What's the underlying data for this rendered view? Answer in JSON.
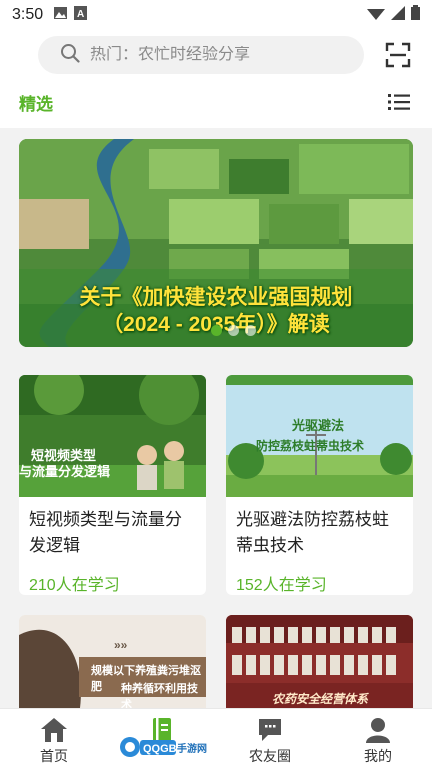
{
  "status_bar": {
    "time": "3:50"
  },
  "search": {
    "placeholder": "热门：农忙时经验分享"
  },
  "tabs": {
    "featured_label": "精选"
  },
  "banner": {
    "title_line1": "关于《加快建设农业强国规划",
    "title_line2": "（2024 - 2035年）》解读",
    "dot_count": 3,
    "active_dot": 0
  },
  "courses": [
    {
      "title": "短视频类型与流量分发逻辑",
      "learners": "210人在学习",
      "thumb_text_1": "短视频类型",
      "thumb_text_2": "与流量分发逻辑"
    },
    {
      "title": "光驱避法防控荔枝蛀蒂虫技术",
      "learners": "152人在学习",
      "thumb_text_1": "光驱避法",
      "thumb_text_2": "防控荔枝蛀蒂虫技术"
    },
    {
      "thumb_text_1": "规模以下养殖粪污堆沤肥",
      "thumb_text_2": "种养循环利用技术"
    },
    {
      "thumb_text_1": "农药安全经营体系"
    }
  ],
  "bottom_nav": {
    "items": [
      {
        "label": "首页",
        "icon": "home-icon"
      },
      {
        "label": "",
        "icon": "book-icon"
      },
      {
        "label": "农友圈",
        "icon": "chat-icon"
      },
      {
        "label": "我的",
        "icon": "user-icon"
      }
    ]
  },
  "watermark": {
    "text": "QQGB手游网"
  },
  "colors": {
    "accent": "#59b42a",
    "banner_title": "#ffe33b"
  }
}
